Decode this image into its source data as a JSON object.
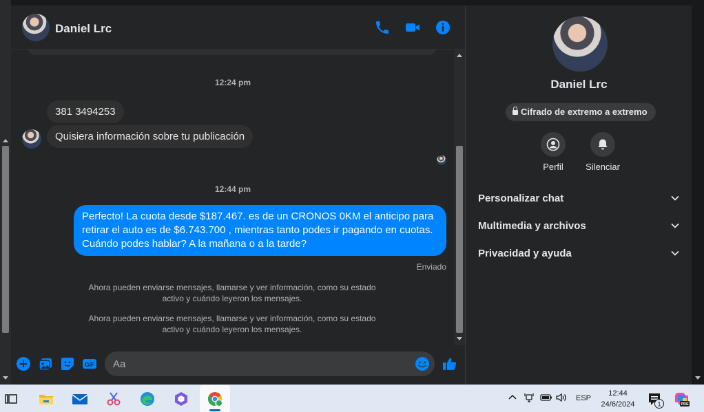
{
  "header": {
    "contact_name": "Daniel Lrc",
    "icons": [
      "phone-icon",
      "video-camera-icon",
      "info-icon"
    ]
  },
  "messages": {
    "timestamp_1": "12:24 pm",
    "incoming_1": "381 3494253",
    "incoming_2": "Quisiera información sobre tu publicación",
    "timestamp_2": "12:44 pm",
    "outgoing_1": "Perfecto! La cuota desde $187.467. es de un CRONOS 0KM el anticipo para retirar el auto es de $6.743.700 , mientras tanto podes ir pagando en cuotas. Cuándo podes hablar? A la mañana o a la tarde?",
    "outgoing_status": "Enviado",
    "system_1": "Ahora pueden enviarse mensajes, llamarse y ver información, como su estado activo y cuándo leyeron los mensajes.",
    "system_2": "Ahora pueden enviarse mensajes, llamarse y ver información, como su estado activo y cuándo leyeron los mensajes."
  },
  "composer": {
    "placeholder": "Aa",
    "icons": [
      "plus-icon",
      "gallery-icon",
      "sticker-icon",
      "gif-icon",
      "emoji-icon",
      "thumbs-up-icon"
    ],
    "gif_label": "GIF"
  },
  "info_panel": {
    "name": "Daniel Lrc",
    "encryption_badge": "Cifrado de extremo a extremo",
    "actions": [
      {
        "label": "Perfil",
        "icon": "profile-icon"
      },
      {
        "label": "Silenciar",
        "icon": "bell-icon"
      }
    ],
    "sections": [
      {
        "label": "Personalizar chat"
      },
      {
        "label": "Multimedia y archivos"
      },
      {
        "label": "Privacidad y ayuda"
      }
    ]
  },
  "taskbar": {
    "apps": [
      "task-view-icon",
      "file-explorer-icon",
      "mail-icon",
      "snipping-tool-icon",
      "edge-icon",
      "copilot-icon",
      "chrome-icon"
    ],
    "tray": {
      "language": "ESP",
      "time": "12:44",
      "date": "24/6/2024",
      "notification_count": "1",
      "copilot_badge": "PRE"
    }
  },
  "colors": {
    "accent": "#0084ff",
    "background": "#242526",
    "incoming_bubble": "#303030",
    "text": "#e4e6eb",
    "muted_text": "#b0b3b8"
  }
}
